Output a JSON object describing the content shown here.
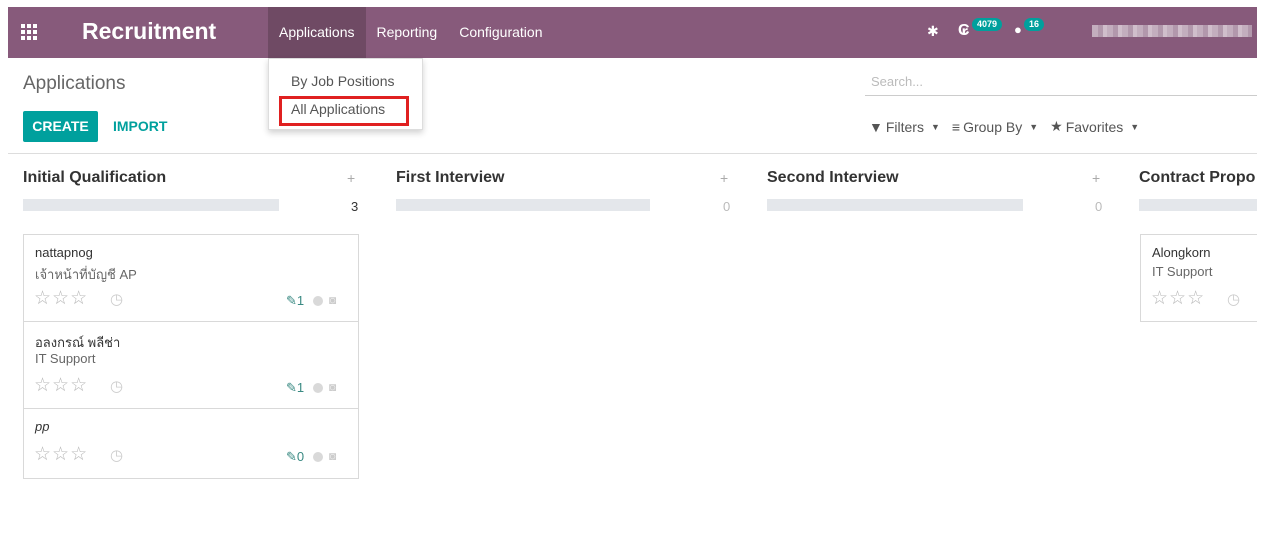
{
  "navbar": {
    "brand": "Recruitment",
    "menu": [
      {
        "label": "Applications",
        "active": true
      },
      {
        "label": "Reporting",
        "active": false
      },
      {
        "label": "Configuration",
        "active": false
      }
    ],
    "activity_count": "4079",
    "message_count": "16",
    "accent_color": "#875a7b"
  },
  "dropdown": {
    "items": [
      "By Job Positions",
      "All Applications"
    ],
    "highlighted": "All Applications"
  },
  "control_panel": {
    "title": "Applications",
    "create_label": "CREATE",
    "import_label": "IMPORT",
    "search_placeholder": "Search...",
    "filters_label": "Filters",
    "group_by_label": "Group By",
    "favorites_label": "Favorites"
  },
  "columns": [
    {
      "title": "Initial Qualification",
      "count": "3"
    },
    {
      "title": "First Interview",
      "count": "0"
    },
    {
      "title": "Second Interview",
      "count": "0"
    },
    {
      "title": "Contract Propo"
    }
  ],
  "cards": [
    {
      "name": "nattapnog",
      "job": "เจ้าหน้าที่บัญชี AP",
      "attachments": "1"
    },
    {
      "name": "อลงกรณ์ พลีช่า",
      "job": "IT Support",
      "attachments": "1"
    },
    {
      "name": "pp",
      "job": "",
      "attachments": "0"
    }
  ],
  "contract_card": {
    "name": "Alongkorn",
    "job": "IT Support"
  },
  "icons": {
    "apps": "apps-grid-icon",
    "bug": "bug-icon",
    "activity": "activity-clock-icon",
    "chat": "chat-icon",
    "filter": "funnel-icon",
    "group": "bars-icon",
    "favorite": "star-icon",
    "star": "star-outline-icon",
    "clock": "clock-icon",
    "paperclip": "paperclip-icon",
    "camera": "camera-icon"
  }
}
